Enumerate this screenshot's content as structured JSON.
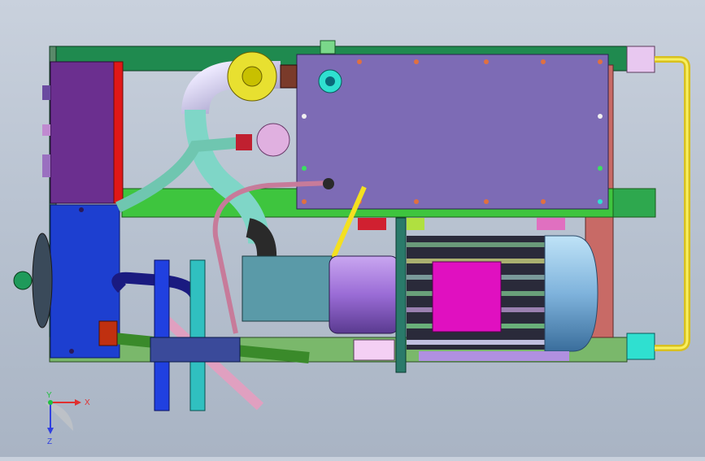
{
  "view": {
    "background_top": "#c9d1dd",
    "background_bottom": "#a9b4c4"
  },
  "triad": {
    "x_label": "X",
    "y_label": "Y",
    "z_label": "Z",
    "x_color": "#e03030",
    "y_color": "#20c040",
    "z_color": "#3040e0"
  },
  "colors": {
    "frame_green": "#1f8a4f",
    "plate_purple": "#7d6bb5",
    "block_purple": "#6b2f8f",
    "block_red": "#e01818",
    "cooler_blue": "#1d3fd0",
    "motor_blue": "#7fb8e0",
    "motor_magenta": "#e010c0",
    "hose_teal": "#7fd6c7",
    "hose_pink": "#c77b9a",
    "pipe_yellow": "#f4e020",
    "fitting_cyan": "#2fe0d0"
  }
}
